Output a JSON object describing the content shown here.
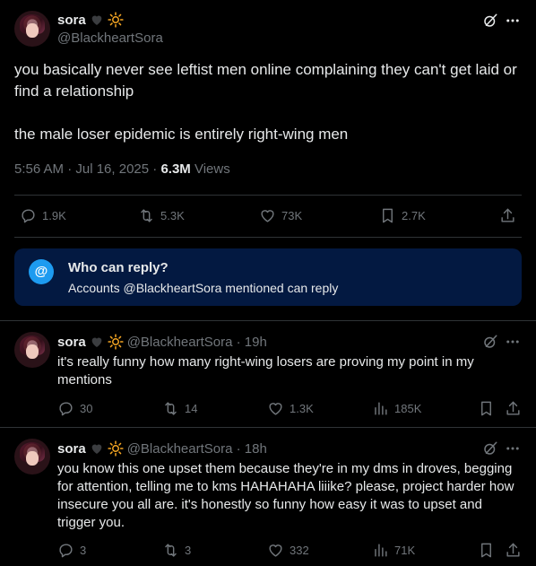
{
  "main_post": {
    "display_name": "sora",
    "handle": "@BlackheartSora",
    "text_para1": "you basically never see leftist men online complaining they can't get laid or find a relationship",
    "text_para2": "the male loser epidemic is entirely right-wing men",
    "timestamp": "5:56 AM · Jul 16, 2025 · ",
    "views_count": "6.3M",
    "views_label": " Views",
    "replies": "1.9K",
    "reposts": "5.3K",
    "likes": "73K",
    "bookmarks": "2.7K"
  },
  "who_can_reply": {
    "title": "Who can reply?",
    "subtitle": "Accounts @BlackheartSora mentioned can reply",
    "icon": "@"
  },
  "replies": [
    {
      "display_name": "sora",
      "handle_time": "@BlackheartSora · 19h",
      "text": "it's really funny how many right-wing losers are proving my point in my mentions",
      "replies": "30",
      "reposts": "14",
      "likes": "1.3K",
      "views": "185K"
    },
    {
      "display_name": "sora",
      "handle_time": "@BlackheartSora · 18h",
      "text": "you know this one upset them because they're in my dms in droves, begging for attention, telling me to kms HAHAHAHA liiike? please, project harder how insecure you all are. it's honestly so funny how easy it was to upset and trigger you.",
      "replies": "3",
      "reposts": "3",
      "likes": "332",
      "views": "71K"
    }
  ],
  "colors": {
    "background": "#000000",
    "text": "#e7e9ea",
    "muted": "#71767b",
    "accent": "#1d9bf0",
    "reply_box": "#031941",
    "divider": "#2f3336"
  },
  "icons": [
    "black-heart-icon",
    "sun-icon",
    "grok-icon",
    "more-icon",
    "reply-icon",
    "repost-icon",
    "like-icon",
    "bookmark-icon",
    "share-icon",
    "views-icon",
    "at-icon"
  ]
}
